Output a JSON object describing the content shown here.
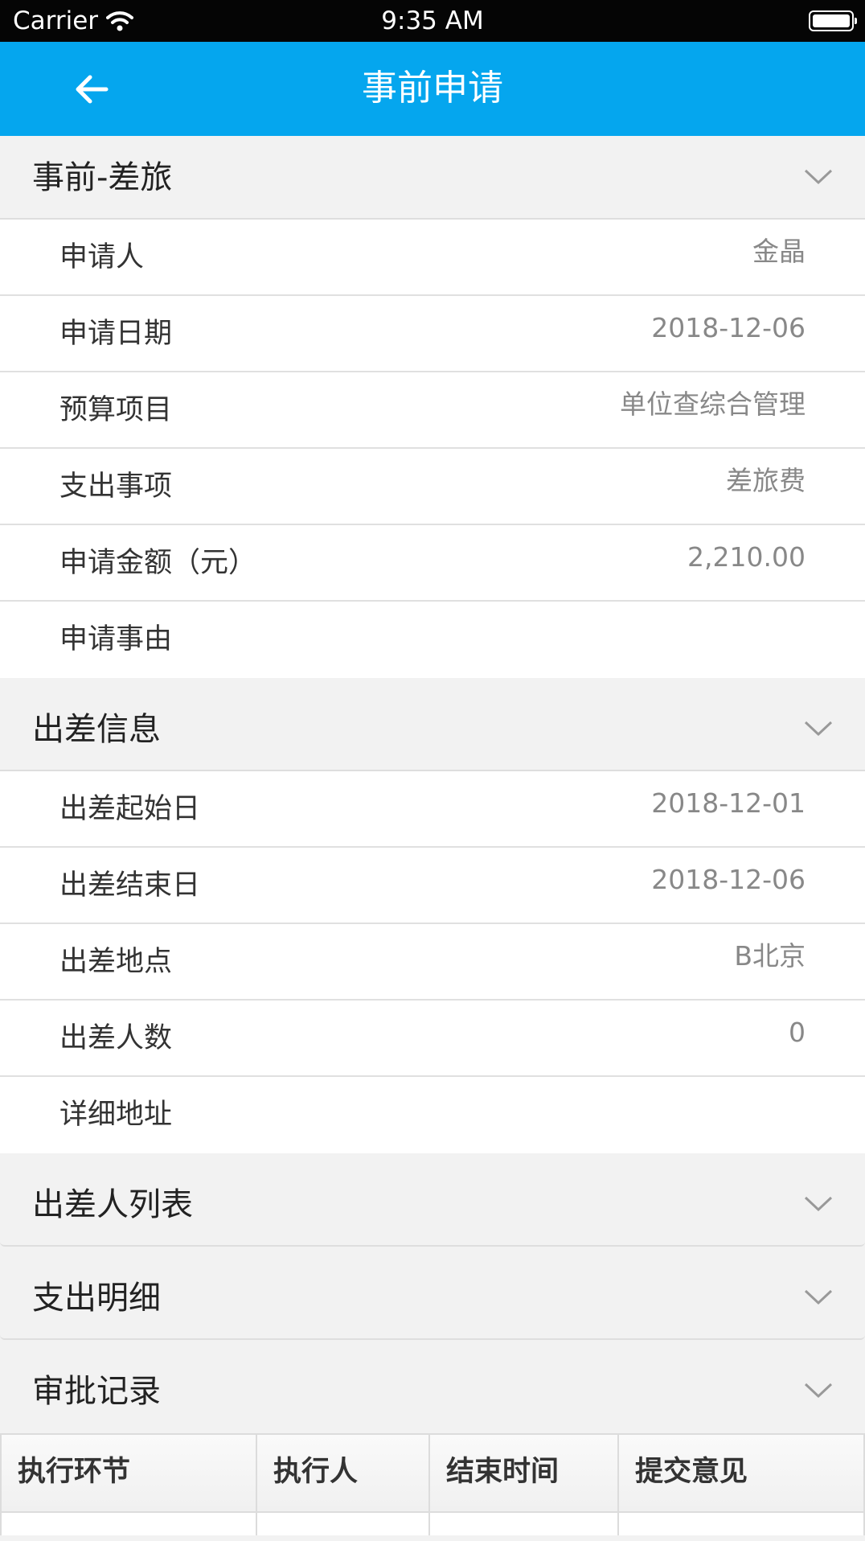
{
  "status_bar": {
    "carrier": "Carrier",
    "time": "9:35 AM"
  },
  "nav": {
    "title": "事前申请",
    "back_icon": "arrow-left-icon"
  },
  "sections": {
    "pre_travel": {
      "title": "事前-差旅",
      "rows": [
        {
          "label": "申请人",
          "value": "金晶"
        },
        {
          "label": "申请日期",
          "value": "2018-12-06"
        },
        {
          "label": "预算项目",
          "value": "单位查综合管理"
        },
        {
          "label": "支出事项",
          "value": "差旅费"
        },
        {
          "label": "申请金额（元）",
          "value": "2,210.00"
        },
        {
          "label": "申请事由",
          "value": ""
        }
      ]
    },
    "trip_info": {
      "title": "出差信息",
      "rows": [
        {
          "label": "出差起始日",
          "value": "2018-12-01"
        },
        {
          "label": "出差结束日",
          "value": "2018-12-06"
        },
        {
          "label": "出差地点",
          "value": "B北京"
        },
        {
          "label": "出差人数",
          "value": "0"
        },
        {
          "label": "详细地址",
          "value": ""
        }
      ]
    },
    "traveler_list": {
      "title": "出差人列表"
    },
    "expense_detail": {
      "title": "支出明细"
    },
    "approval_records": {
      "title": "审批记录",
      "columns": [
        "执行环节",
        "执行人",
        "结束时间",
        "提交意见"
      ]
    }
  }
}
